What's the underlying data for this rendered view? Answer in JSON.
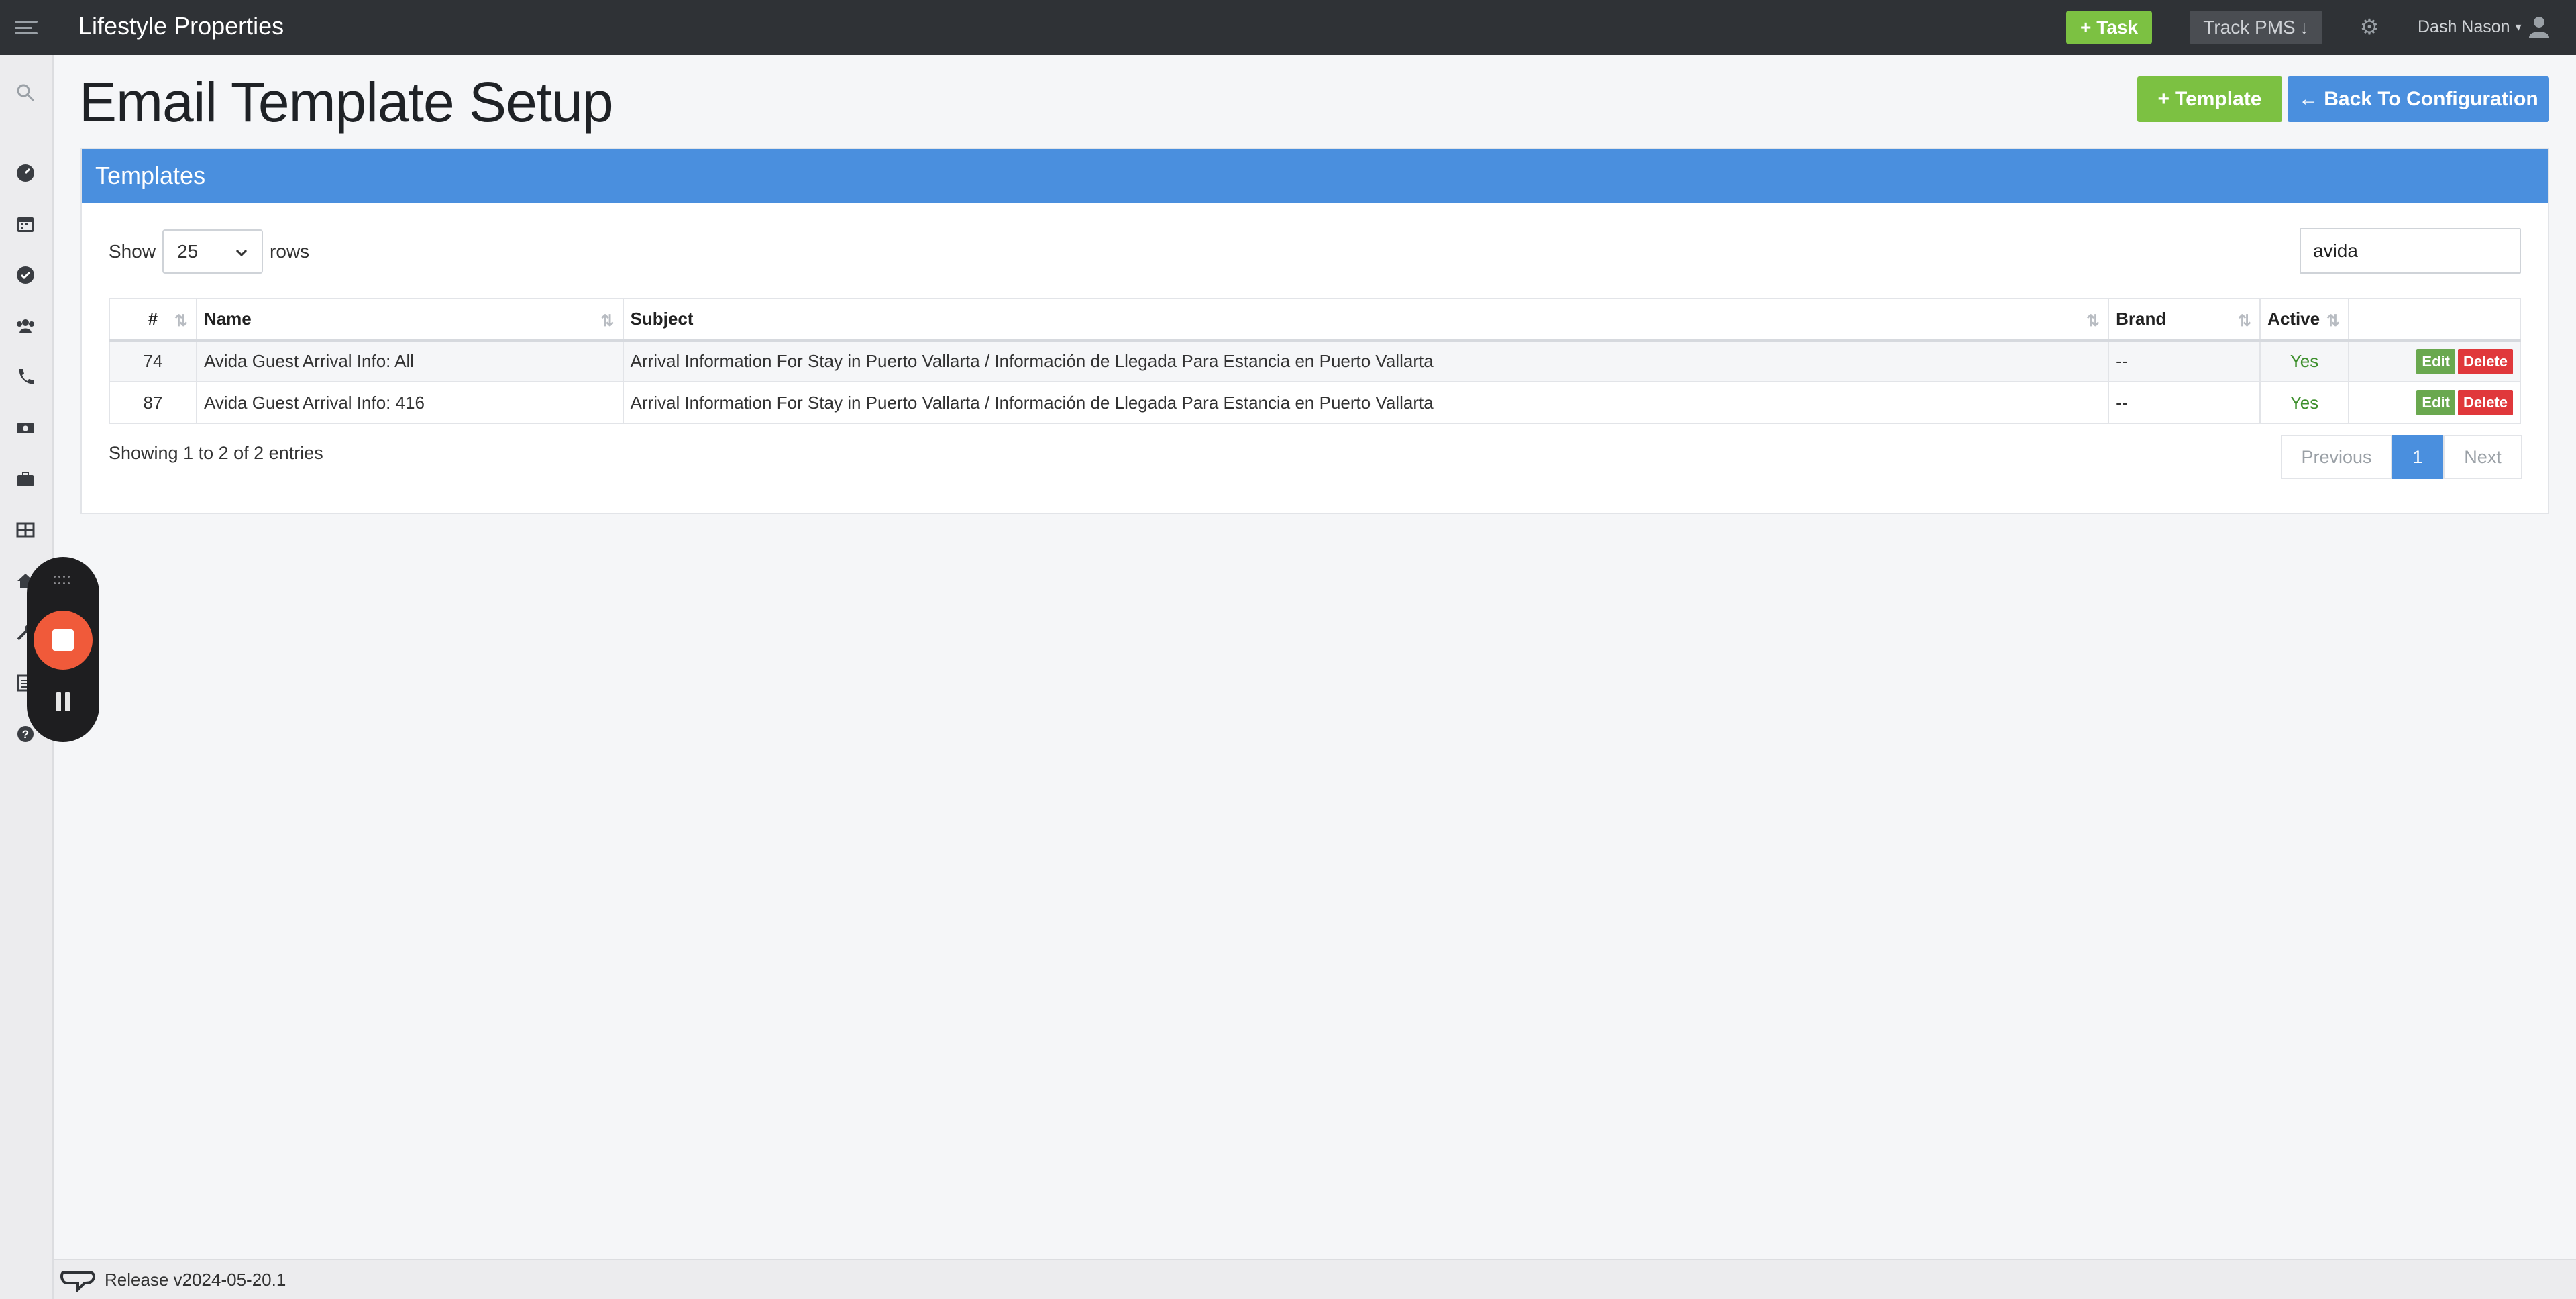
{
  "topbar": {
    "brand": "Lifestyle Properties",
    "task_label": "Task",
    "track_label": "Track PMS",
    "user_name": "Dash Nason"
  },
  "sidebar": {
    "icons": [
      "search-icon",
      "dashboard-icon",
      "calendar-icon",
      "check-circle-icon",
      "users-icon",
      "phone-icon",
      "money-icon",
      "briefcase-icon",
      "grid-icon",
      "home-icon",
      "wrench-icon",
      "report-icon",
      "help-icon"
    ]
  },
  "page": {
    "title": "Email Template Setup",
    "add_template_label": "Template",
    "back_label": "Back To Configuration"
  },
  "panel": {
    "heading": "Templates",
    "show_label": "Show",
    "rows_value": "25",
    "rows_label": "rows",
    "search_value": "avida",
    "columns": [
      "#",
      "Name",
      "Subject",
      "Brand",
      "Active",
      ""
    ],
    "rows": [
      {
        "id": "74",
        "name": "Avida Guest Arrival Info: All",
        "subject": "Arrival Information For Stay in Puerto Vallarta / Información de Llegada Para Estancia en Puerto Vallarta",
        "brand": "--",
        "active": "Yes",
        "edit": "Edit",
        "delete": "Delete"
      },
      {
        "id": "87",
        "name": "Avida Guest Arrival Info: 416",
        "subject": "Arrival Information For Stay in Puerto Vallarta / Información de Llegada Para Estancia en Puerto Vallarta",
        "brand": "--",
        "active": "Yes",
        "edit": "Edit",
        "delete": "Delete"
      }
    ],
    "showing_text": "Showing 1 to 2 of 2 entries",
    "pager": {
      "previous": "Previous",
      "current": "1",
      "next": "Next"
    }
  },
  "footer": {
    "release": "Release v2024-05-20.1"
  },
  "colors": {
    "topbar": "#2f3236",
    "accent_green": "#7cc142",
    "accent_blue": "#4a8fde",
    "danger_red": "#e0383b",
    "recorder_stop": "#f05a3a"
  }
}
